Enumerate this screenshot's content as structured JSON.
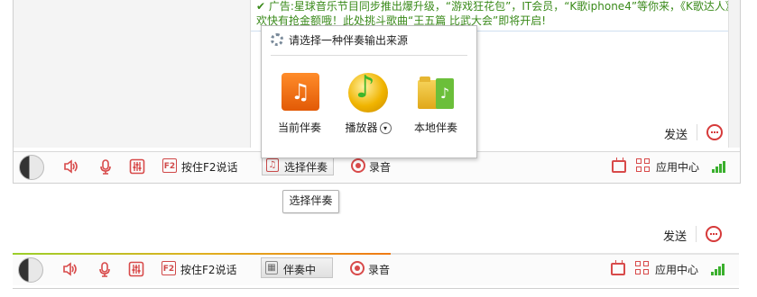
{
  "chat": {
    "line1": "✔ 广告:星球音乐节目同步推出爆升级，“游戏狂花包”，IT会员，“K歌iphone4”等你来，《K歌达人》",
    "line2": "欢快有抢金额哦！此处挑斗歌曲“王五篇 比武大会”即将开启!"
  },
  "send_label": "发送",
  "toolbar": {
    "ptt_key": "F2",
    "ptt_label": "按住F2说话",
    "accompany_select_label": "选择伴奏",
    "accompany_playing_label": "伴奏中",
    "record_label": "录音",
    "app_center_label": "应用中心"
  },
  "popup": {
    "title": "请选择一种伴奏输出来源",
    "options": [
      {
        "label": "当前伴奏",
        "icon": "current-accompaniment-icon"
      },
      {
        "label": "播放器",
        "icon": "player-icon"
      },
      {
        "label": "本地伴奏",
        "icon": "local-accompaniment-icon"
      }
    ]
  },
  "tooltip": "选择伴奏",
  "accompaniment_progress": 0.52,
  "icons": {
    "avatar": "avatar-icon",
    "speaker": "speaker-icon",
    "mic": "microphone-icon",
    "mixer": "mixer-icon",
    "record": "record-icon",
    "tv": "tv-icon",
    "apps": "app-center-icon",
    "signal": "signal-icon",
    "emoji": "emoji-icon"
  },
  "colors": {
    "accent_red": "#d84a4a",
    "signal_green": "#3bb02e",
    "chat_green": "#3a8a1a"
  }
}
